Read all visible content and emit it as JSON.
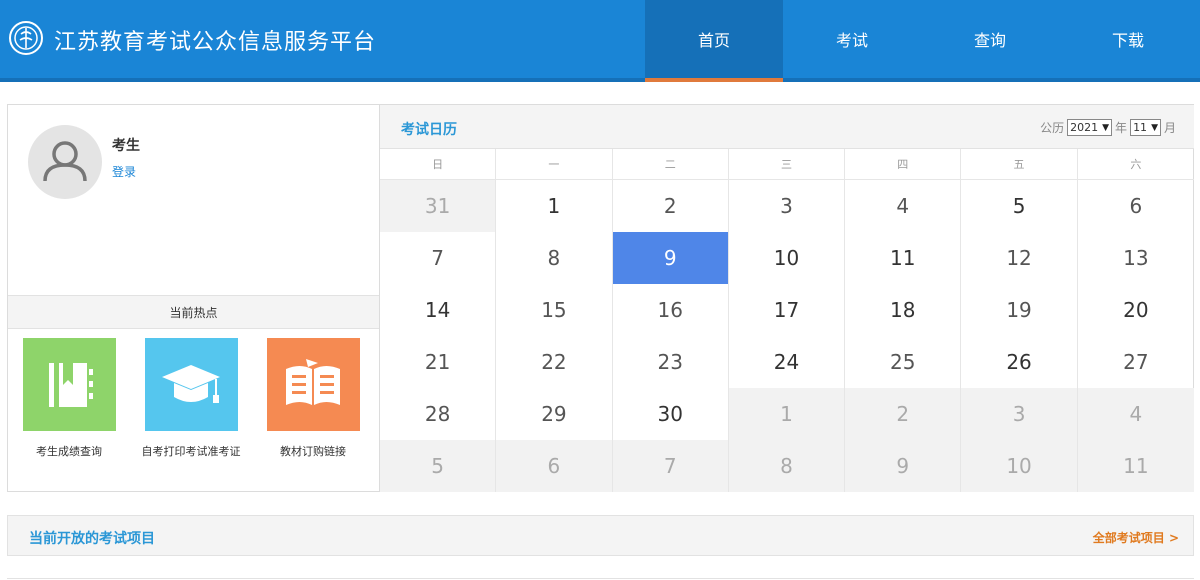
{
  "header": {
    "site_title": "江苏教育考试公众信息服务平台",
    "brand_color": "#1a85d6",
    "nav": [
      {
        "label": "首页",
        "active": true
      },
      {
        "label": "考试",
        "active": false
      },
      {
        "label": "查询",
        "active": false
      },
      {
        "label": "下载",
        "active": false
      }
    ]
  },
  "user": {
    "name": "考生",
    "login_label": "登录"
  },
  "hot": {
    "title": "当前热点",
    "items": [
      {
        "label": "考生成绩查询",
        "icon": "notebook-icon",
        "color": "#8ed46a"
      },
      {
        "label": "自考打印考试准考证",
        "icon": "graduation-cap-icon",
        "color": "#55c6ee"
      },
      {
        "label": "教材订购链接",
        "icon": "book-icon",
        "color": "#f58a52"
      }
    ]
  },
  "calendar": {
    "title": "考试日历",
    "calendar_type_label": "公历",
    "year_value": "2021",
    "year_label": "年",
    "month_value": "11",
    "month_label": "月",
    "weekdays": [
      "日",
      "一",
      "二",
      "三",
      "四",
      "五",
      "六"
    ],
    "days": [
      {
        "n": "31",
        "t": "other"
      },
      {
        "n": "1",
        "t": "dark"
      },
      {
        "n": "2",
        "t": "cur"
      },
      {
        "n": "3",
        "t": "cur"
      },
      {
        "n": "4",
        "t": "cur"
      },
      {
        "n": "5",
        "t": "dark"
      },
      {
        "n": "6",
        "t": "cur"
      },
      {
        "n": "7",
        "t": "cur"
      },
      {
        "n": "8",
        "t": "cur"
      },
      {
        "n": "9",
        "t": "today"
      },
      {
        "n": "10",
        "t": "dark"
      },
      {
        "n": "11",
        "t": "dark"
      },
      {
        "n": "12",
        "t": "cur"
      },
      {
        "n": "13",
        "t": "cur"
      },
      {
        "n": "14",
        "t": "dark"
      },
      {
        "n": "15",
        "t": "cur"
      },
      {
        "n": "16",
        "t": "cur"
      },
      {
        "n": "17",
        "t": "dark"
      },
      {
        "n": "18",
        "t": "dark"
      },
      {
        "n": "19",
        "t": "cur"
      },
      {
        "n": "20",
        "t": "dark"
      },
      {
        "n": "21",
        "t": "cur"
      },
      {
        "n": "22",
        "t": "cur"
      },
      {
        "n": "23",
        "t": "cur"
      },
      {
        "n": "24",
        "t": "dark"
      },
      {
        "n": "25",
        "t": "cur"
      },
      {
        "n": "26",
        "t": "dark"
      },
      {
        "n": "27",
        "t": "cur"
      },
      {
        "n": "28",
        "t": "cur"
      },
      {
        "n": "29",
        "t": "cur"
      },
      {
        "n": "30",
        "t": "dark"
      },
      {
        "n": "1",
        "t": "other"
      },
      {
        "n": "2",
        "t": "other"
      },
      {
        "n": "3",
        "t": "other"
      },
      {
        "n": "4",
        "t": "other"
      },
      {
        "n": "5",
        "t": "other"
      },
      {
        "n": "6",
        "t": "other"
      },
      {
        "n": "7",
        "t": "other"
      },
      {
        "n": "8",
        "t": "other"
      },
      {
        "n": "9",
        "t": "other"
      },
      {
        "n": "10",
        "t": "other"
      },
      {
        "n": "11",
        "t": "other"
      }
    ],
    "today_color": "#4f86e8"
  },
  "exams": {
    "title": "当前开放的考试项目",
    "all_link": "全部考试项目 >"
  }
}
